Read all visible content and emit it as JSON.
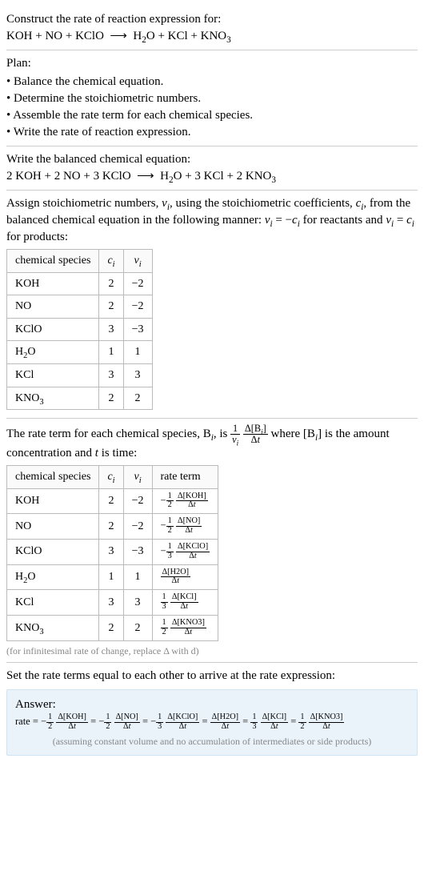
{
  "prompt": {
    "title": "Construct the rate of reaction expression for:",
    "equation_html": "KOH + NO + KClO &nbsp;&#10230;&nbsp; H<sub>2</sub>O + KCl + KNO<sub>3</sub>"
  },
  "plan": {
    "title": "Plan:",
    "items": [
      "Balance the chemical equation.",
      "Determine the stoichiometric numbers.",
      "Assemble the rate term for each chemical species.",
      "Write the rate of reaction expression."
    ]
  },
  "balanced": {
    "title": "Write the balanced chemical equation:",
    "equation_html": "2 KOH + 2 NO + 3 KClO &nbsp;&#10230;&nbsp; H<sub>2</sub>O + 3 KCl + 2 KNO<sub>3</sub>"
  },
  "stoich": {
    "intro_html": "Assign stoichiometric numbers, <span class='italic'>&nu;<sub>i</sub></span>, using the stoichiometric coefficients, <span class='italic'>c<sub>i</sub></span>, from the balanced chemical equation in the following manner: <span class='italic'>&nu;<sub>i</sub></span> = &minus;<span class='italic'>c<sub>i</sub></span> for reactants and <span class='italic'>&nu;<sub>i</sub></span> = <span class='italic'>c<sub>i</sub></span> for products:",
    "headers": {
      "species": "chemical species",
      "c": "c_i",
      "v": "ν_i"
    },
    "rows": [
      {
        "species_html": "KOH",
        "c": "2",
        "v": "−2"
      },
      {
        "species_html": "NO",
        "c": "2",
        "v": "−2"
      },
      {
        "species_html": "KClO",
        "c": "3",
        "v": "−3"
      },
      {
        "species_html": "H<sub>2</sub>O",
        "c": "1",
        "v": "1"
      },
      {
        "species_html": "KCl",
        "c": "3",
        "v": "3"
      },
      {
        "species_html": "KNO<sub>3</sub>",
        "c": "2",
        "v": "2"
      }
    ]
  },
  "rateterms": {
    "intro_html": "The rate term for each chemical species, B<sub><span class='italic'>i</span></sub>, is <span class='frac'><span class='top'>1</span><span class='bot'><span class='italic'>&nu;<sub>i</sub></span></span></span> <span class='frac'><span class='top'>&Delta;[B<sub><span class='italic'>i</span></sub>]</span><span class='bot'>&Delta;<span class='italic'>t</span></span></span> where [B<sub><span class='italic'>i</span></sub>] is the amount concentration and <span class='italic'>t</span> is time:",
    "headers": {
      "species": "chemical species",
      "c": "c_i",
      "v": "ν_i",
      "term": "rate term"
    },
    "rows": [
      {
        "species_html": "KOH",
        "c": "2",
        "v": "−2",
        "term_html": "&minus;<span class='frac'><span class='top'>1</span><span class='bot'>2</span></span> <span class='frac'><span class='top'>&Delta;[KOH]</span><span class='bot'>&Delta;<span class='italic'>t</span></span></span>"
      },
      {
        "species_html": "NO",
        "c": "2",
        "v": "−2",
        "term_html": "&minus;<span class='frac'><span class='top'>1</span><span class='bot'>2</span></span> <span class='frac'><span class='top'>&Delta;[NO]</span><span class='bot'>&Delta;<span class='italic'>t</span></span></span>"
      },
      {
        "species_html": "KClO",
        "c": "3",
        "v": "−3",
        "term_html": "&minus;<span class='frac'><span class='top'>1</span><span class='bot'>3</span></span> <span class='frac'><span class='top'>&Delta;[KClO]</span><span class='bot'>&Delta;<span class='italic'>t</span></span></span>"
      },
      {
        "species_html": "H<sub>2</sub>O",
        "c": "1",
        "v": "1",
        "term_html": "<span class='frac'><span class='top'>&Delta;[H2O]</span><span class='bot'>&Delta;<span class='italic'>t</span></span></span>"
      },
      {
        "species_html": "KCl",
        "c": "3",
        "v": "3",
        "term_html": "<span class='frac'><span class='top'>1</span><span class='bot'>3</span></span> <span class='frac'><span class='top'>&Delta;[KCl]</span><span class='bot'>&Delta;<span class='italic'>t</span></span></span>"
      },
      {
        "species_html": "KNO<sub>3</sub>",
        "c": "2",
        "v": "2",
        "term_html": "<span class='frac'><span class='top'>1</span><span class='bot'>2</span></span> <span class='frac'><span class='top'>&Delta;[KNO3]</span><span class='bot'>&Delta;<span class='italic'>t</span></span></span>"
      }
    ],
    "footnote": "(for infinitesimal rate of change, replace Δ with d)"
  },
  "equalize": {
    "title": "Set the rate terms equal to each other to arrive at the rate expression:"
  },
  "answer": {
    "label": "Answer:",
    "expression_html": "rate = &minus;<span class='frac'><span class='top'>1</span><span class='bot'>2</span></span> <span class='frac'><span class='top'>&Delta;[KOH]</span><span class='bot'>&Delta;<span class='italic'>t</span></span></span> = &minus;<span class='frac'><span class='top'>1</span><span class='bot'>2</span></span> <span class='frac'><span class='top'>&Delta;[NO]</span><span class='bot'>&Delta;<span class='italic'>t</span></span></span> = &minus;<span class='frac'><span class='top'>1</span><span class='bot'>3</span></span> <span class='frac'><span class='top'>&Delta;[KClO]</span><span class='bot'>&Delta;<span class='italic'>t</span></span></span> = <span class='frac'><span class='top'>&Delta;[H2O]</span><span class='bot'>&Delta;<span class='italic'>t</span></span></span> = <span class='frac'><span class='top'>1</span><span class='bot'>3</span></span> <span class='frac'><span class='top'>&Delta;[KCl]</span><span class='bot'>&Delta;<span class='italic'>t</span></span></span> = <span class='frac'><span class='top'>1</span><span class='bot'>2</span></span> <span class='frac'><span class='top'>&Delta;[KNO3]</span><span class='bot'>&Delta;<span class='italic'>t</span></span></span>",
    "note": "(assuming constant volume and no accumulation of intermediates or side products)"
  }
}
